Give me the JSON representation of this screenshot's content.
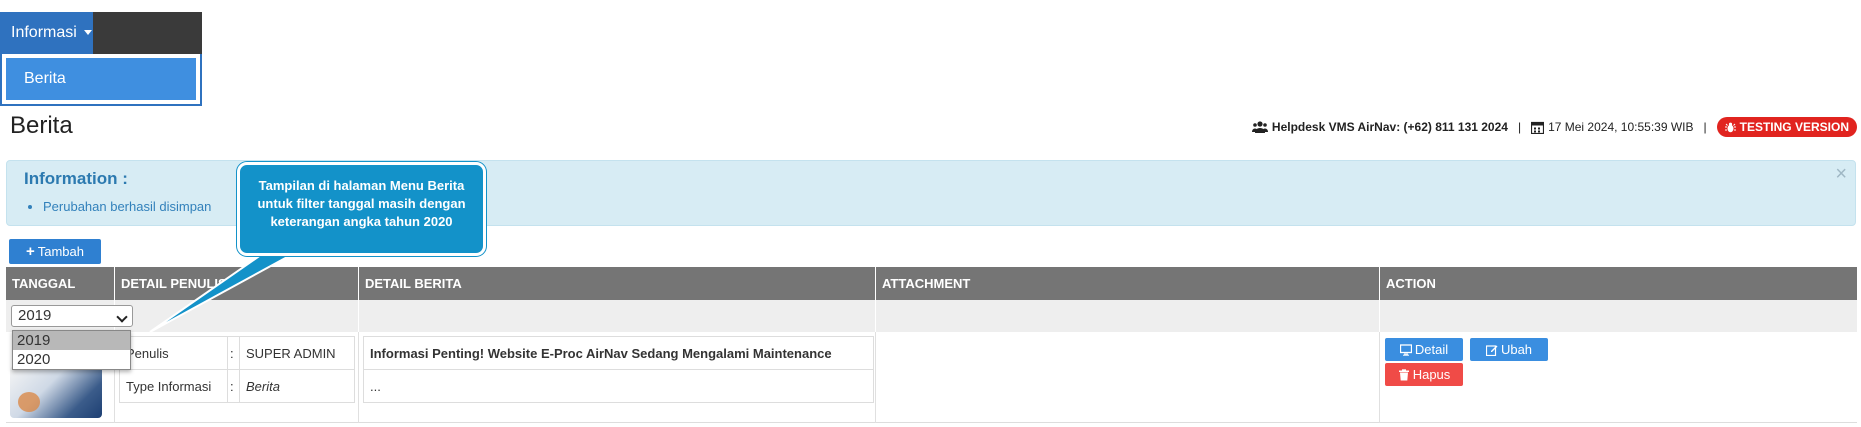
{
  "nav": {
    "menu_label": "Informasi",
    "dropdown_items": [
      "Berita"
    ]
  },
  "page": {
    "title": "Berita"
  },
  "status": {
    "helpdesk": "Helpdesk VMS AirNav: (+62) 811 131 2024",
    "datetime": "17 Mei 2024, 10:55:39 WIB",
    "separator": "|",
    "badge": "TESTING VERSION",
    "badge_color": "#e1241f"
  },
  "alert": {
    "title": "Information :",
    "messages": [
      "Perubahan berhasil disimpan"
    ],
    "close": "×"
  },
  "toolbar": {
    "add_label": "Tambah"
  },
  "table": {
    "headers": [
      "TANGGAL",
      "DETAIL PENULIS",
      "DETAIL BERITA",
      "ATTACHMENT",
      "ACTION"
    ],
    "year_filter": {
      "selected": "2019",
      "options": [
        "2019",
        "2020"
      ]
    },
    "rows": [
      {
        "penulis_label": "Penulis",
        "penulis_sep": ":",
        "penulis_value": "SUPER ADMIN",
        "type_label": "Type Informasi",
        "type_sep": ":",
        "type_value": "Berita",
        "title": "Informasi Penting! Website E-Proc AirNav Sedang Mengalami Maintenance",
        "excerpt": "...",
        "actions": {
          "detail": "Detail",
          "edit": "Ubah",
          "delete": "Hapus"
        }
      }
    ]
  },
  "callout": {
    "text": "Tampilan di halaman Menu Berita untuk filter tanggal masih dengan keterangan angka tahun 2020"
  },
  "colors": {
    "primary": "#2f80d1",
    "danger": "#f04b47",
    "header_gray": "#757575",
    "callout": "#1392c9"
  }
}
